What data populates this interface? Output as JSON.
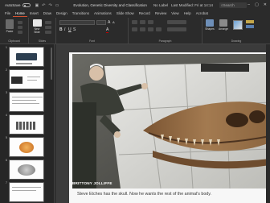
{
  "titlebar": {
    "autosave_label": "AutoSave",
    "autosave_state": "Off",
    "doc_title": "Evolution, Genetic Diversity and Classification",
    "label_status": "No Label",
    "modified": "Last Modified: Fri at 14:14",
    "search_placeholder": "Search"
  },
  "ribbon": {
    "tabs": [
      "File",
      "Home",
      "Insert",
      "Draw",
      "Design",
      "Transitions",
      "Animations",
      "Slide Show",
      "Record",
      "Review",
      "View",
      "Help",
      "Acrobat"
    ],
    "active_tab": "Home",
    "groups": {
      "clipboard": "Clipboard",
      "slides": "Slides",
      "font": "Font",
      "paragraph": "Paragraph",
      "drawing": "Drawing"
    },
    "buttons": {
      "paste": "Paste",
      "new_slide": "New Slide",
      "shapes": "Shapes",
      "arrange": "Arrange"
    }
  },
  "thumbnails": [
    "1",
    "2",
    "3",
    "4",
    "5",
    "6",
    "7",
    "8"
  ],
  "slide": {
    "credit": "BRITTONY JOLLIFFE",
    "caption": "Steve Etches has the skull. Now he wants the rest of the animal's body."
  },
  "colors": {
    "accent": "#d35230",
    "app_bg": "#1f1f1f",
    "ribbon_bg": "#2b2b2b"
  }
}
